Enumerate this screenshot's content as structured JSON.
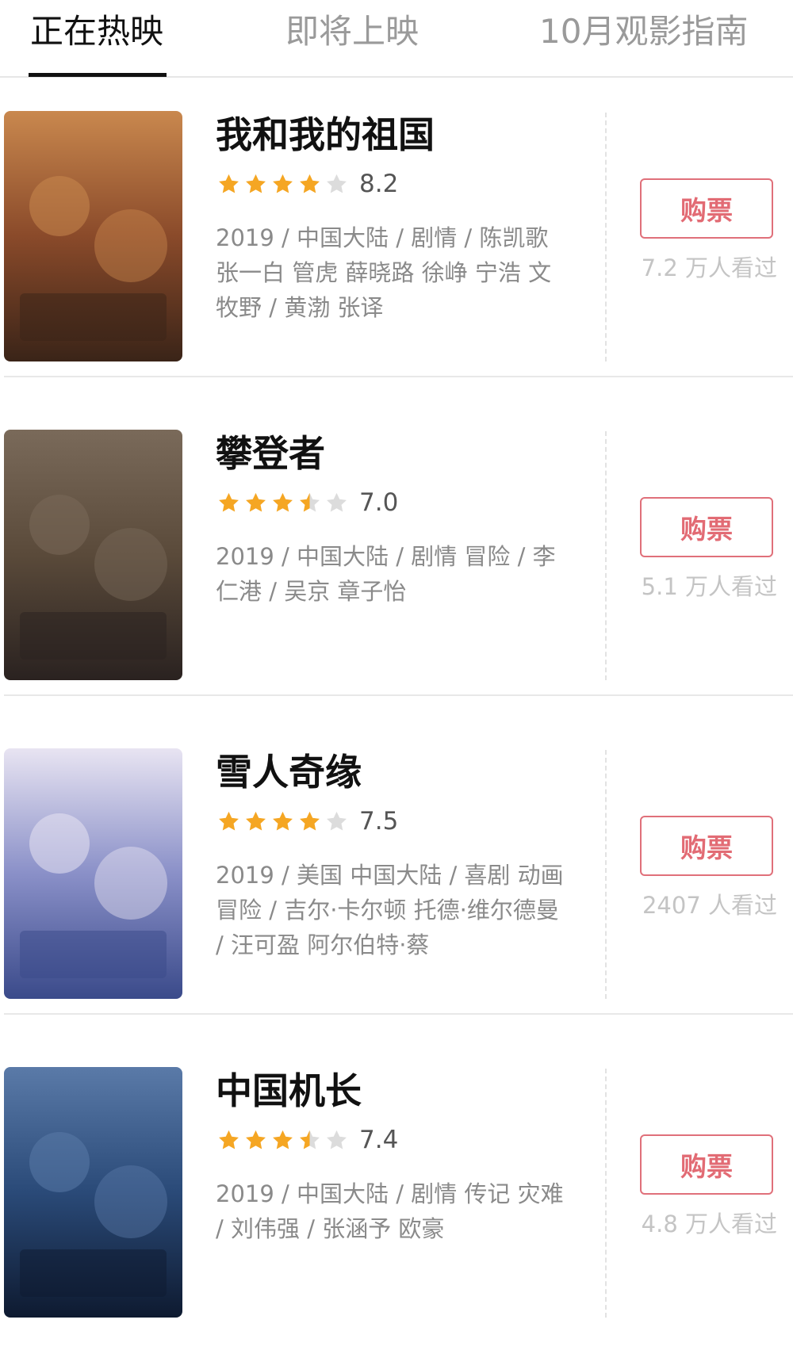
{
  "tabs": [
    {
      "label": "正在热映",
      "active": true
    },
    {
      "label": "即将上映",
      "active": false
    },
    {
      "label": "10月观影指南",
      "active": false
    }
  ],
  "colors": {
    "star_filled": "#f5a623",
    "star_empty": "#dcdcdc",
    "buy_button": "#e26b74",
    "info_text": "#8a8a8a"
  },
  "buy_label": "购票",
  "movies": [
    {
      "title": "我和我的祖国",
      "stars": 4,
      "score": "8.2",
      "info": "2019 / 中国大陆 / 剧情 / 陈凯歌 张一白 管虎 薛晓路 徐峥 宁浩 文牧野 / 黄渤 张译",
      "watched": "7.2 万人看过",
      "poster": {
        "theme": "red-sepia",
        "icon": "movie-poster-icon"
      }
    },
    {
      "title": "攀登者",
      "stars": 3.5,
      "score": "7.0",
      "info": "2019 / 中国大陆 / 剧情 冒险 / 李仁港 / 吴京 章子怡",
      "watched": "5.1 万人看过",
      "poster": {
        "theme": "dark-brown",
        "icon": "movie-poster-icon"
      }
    },
    {
      "title": "雪人奇缘",
      "stars": 4,
      "score": "7.5",
      "info": "2019 / 美国 中国大陆 / 喜剧 动画 冒险 / 吉尔·卡尔顿 托德·维尔德曼 / 汪可盈 阿尔伯特·蔡",
      "watched": "2407 人看过",
      "poster": {
        "theme": "snow-blue",
        "icon": "movie-poster-icon"
      }
    },
    {
      "title": "中国机长",
      "stars": 3.5,
      "score": "7.4",
      "info": "2019 / 中国大陆 / 剧情 传记 灾难 / 刘伟强 / 张涵予 欧豪",
      "watched": "4.8 万人看过",
      "poster": {
        "theme": "navy-blue",
        "icon": "movie-poster-icon"
      }
    }
  ]
}
